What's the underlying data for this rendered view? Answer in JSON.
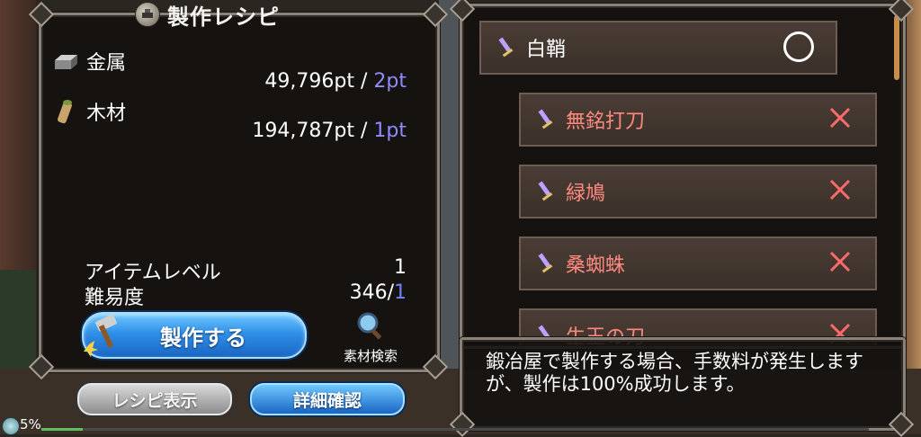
{
  "title": "製作レシピ",
  "materials": [
    {
      "name": "金属",
      "icon": "metal-ingot-icon",
      "have": "49,796pt",
      "sep": " / ",
      "need": "2pt"
    },
    {
      "name": "木材",
      "icon": "wood-log-icon",
      "have": "194,787pt",
      "sep": " / ",
      "need": "1pt"
    }
  ],
  "stats": {
    "item_level_label": "アイテムレベル",
    "item_level_value": "1",
    "difficulty_label": "難易度",
    "difficulty_value": "346/",
    "difficulty_req": "1"
  },
  "buttons": {
    "create": "製作する",
    "search": "素材検索",
    "recipe_display": "レシピ表示",
    "details": "詳細確認"
  },
  "recipes": {
    "main": {
      "name": "白鞘",
      "status": "circle"
    },
    "subs": [
      {
        "name": "無銘打刀",
        "status": "×"
      },
      {
        "name": "緑鳩",
        "status": "×"
      },
      {
        "name": "桑蜘蛛",
        "status": "×"
      },
      {
        "name": "生玉の刀",
        "status": "×"
      }
    ]
  },
  "description": "鍛冶屋で製作する場合、手数料が発生しますが、製作は100%成功します。",
  "progress": {
    "percent_label": "5%",
    "percent": 5
  },
  "colors": {
    "required_pt": "#8f8cff",
    "fail_mark": "#ff6b6b",
    "create_button": "#2f8fe8"
  }
}
